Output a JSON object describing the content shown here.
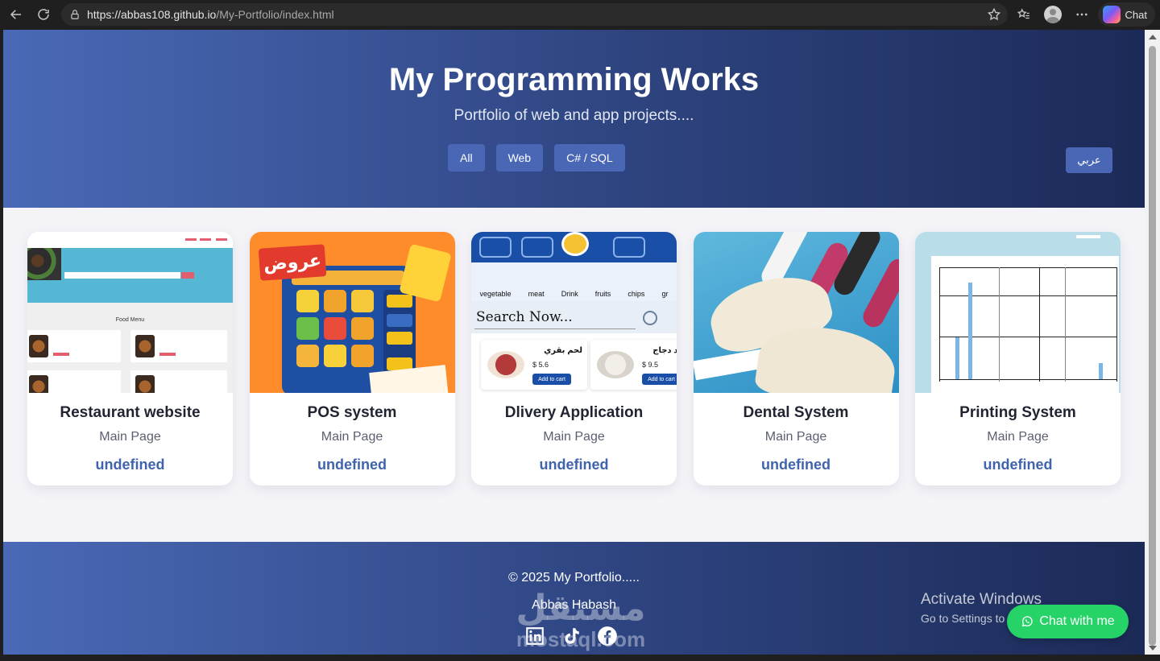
{
  "browser": {
    "url_host": "https://abbas108.github.io",
    "url_path": "/My-Portfolio/index.html",
    "chat_label": "Chat",
    "icons": [
      "back-icon",
      "reload-icon",
      "lock-icon",
      "star-icon",
      "favorites-icon",
      "profile-icon",
      "more-icon",
      "copilot-icon"
    ]
  },
  "hero": {
    "title": "My Programming Works",
    "subtitle": "Portfolio of web and app projects....",
    "filters": [
      "All",
      "Web",
      "C# / SQL"
    ],
    "language_button": "عربي"
  },
  "projects": [
    {
      "title": "Restaurant website",
      "subtitle": "Main Page",
      "link": "undefined",
      "thumb_text": "Food Menu"
    },
    {
      "title": "POS system",
      "subtitle": "Main Page",
      "link": "undefined",
      "thumb_text": "عروض"
    },
    {
      "title": "Dlivery Application",
      "subtitle": "Main Page",
      "link": "undefined",
      "thumb_categories": [
        "vegetable",
        "meat",
        "Drink",
        "fruits",
        "chips",
        "gr"
      ],
      "thumb_search": "Search Now...",
      "thumb_products": [
        {
          "name": "لحم بقري",
          "price": "$ 5.6",
          "button": "Add to cart"
        },
        {
          "name": "فخاد دجاج",
          "price": "$ 9.5",
          "button": "Add to cart"
        }
      ]
    },
    {
      "title": "Dental System",
      "subtitle": "Main Page",
      "link": "undefined"
    },
    {
      "title": "Printing System",
      "subtitle": "Main Page",
      "link": "undefined"
    }
  ],
  "footer": {
    "copyright": "© 2025 My Portfolio.....",
    "author": "Abbas Habash",
    "socials": [
      "linkedin-icon",
      "tiktok-icon",
      "facebook-icon"
    ]
  },
  "chat_button": {
    "label": "Chat with me",
    "color": "#25d366"
  },
  "os_overlay": {
    "title": "Activate Windows",
    "subtitle": "Go to Settings to activate Windows."
  },
  "watermark": {
    "arabic": "مستقل",
    "latin": "mostaql.com"
  },
  "colors": {
    "hero_start": "#4a69b6",
    "hero_end": "#1c2a57",
    "button": "#4a67b6",
    "link": "#3f63ad"
  }
}
